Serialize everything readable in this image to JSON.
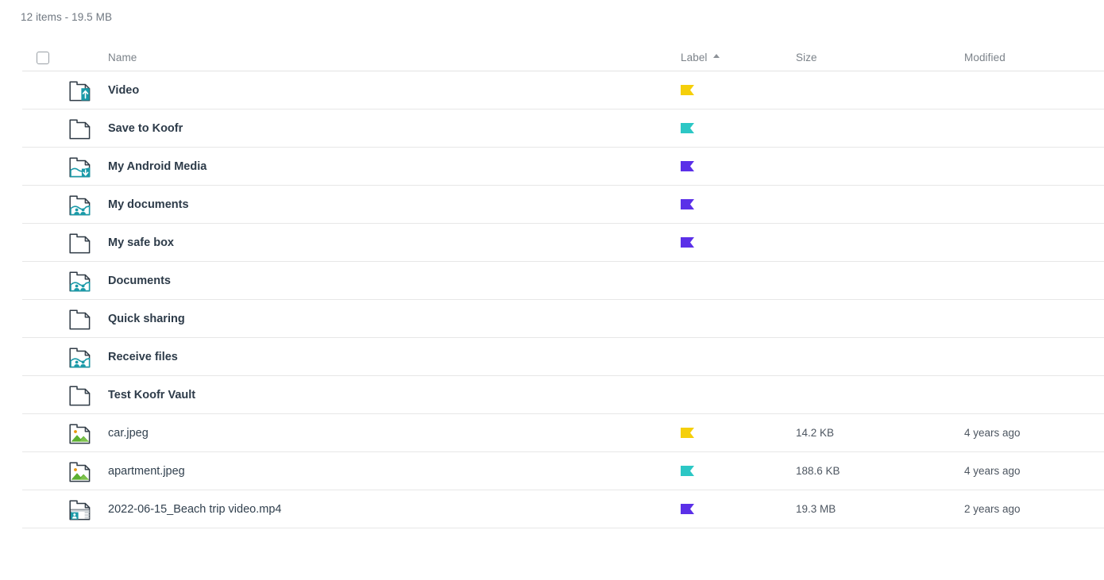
{
  "summary": "12 items - 19.5 MB",
  "columns": {
    "checkbox_name": "select-all",
    "name": "Name",
    "label": "Label",
    "size": "Size",
    "modified": "Modified",
    "sorted_by": "Label",
    "sort_direction": "ascending"
  },
  "label_colors": {
    "yellow": "#f5cf0a",
    "teal": "#2cc7c5",
    "purple": "#5b30e8"
  },
  "rows": [
    {
      "name": "Video",
      "icon": "document-upload-icon",
      "kind": "folder",
      "label_color": "#f5cf0a",
      "size": "",
      "modified": ""
    },
    {
      "name": "Save to Koofr",
      "icon": "document-icon",
      "kind": "folder",
      "label_color": "#2cc7c5",
      "size": "",
      "modified": ""
    },
    {
      "name": "My Android Media",
      "icon": "document-download-icon",
      "kind": "folder",
      "label_color": "#5b30e8",
      "size": "",
      "modified": ""
    },
    {
      "name": "My documents",
      "icon": "document-shared-icon",
      "kind": "folder",
      "label_color": "#5b30e8",
      "size": "",
      "modified": ""
    },
    {
      "name": "My safe box",
      "icon": "document-icon",
      "kind": "folder",
      "label_color": "#5b30e8",
      "size": "",
      "modified": ""
    },
    {
      "name": "Documents",
      "icon": "document-shared-icon",
      "kind": "folder",
      "label_color": "",
      "size": "",
      "modified": ""
    },
    {
      "name": "Quick sharing",
      "icon": "document-icon",
      "kind": "folder",
      "label_color": "",
      "size": "",
      "modified": ""
    },
    {
      "name": "Receive files",
      "icon": "document-shared-icon",
      "kind": "folder",
      "label_color": "",
      "size": "",
      "modified": ""
    },
    {
      "name": "Test Koofr Vault",
      "icon": "document-icon",
      "kind": "folder",
      "label_color": "",
      "size": "",
      "modified": ""
    },
    {
      "name": "car.jpeg",
      "icon": "image-file-icon",
      "kind": "file",
      "label_color": "#f5cf0a",
      "size": "14.2 KB",
      "modified": "4 years ago"
    },
    {
      "name": "apartment.jpeg",
      "icon": "image-file-icon",
      "kind": "file",
      "label_color": "#2cc7c5",
      "size": "188.6 KB",
      "modified": "4 years ago"
    },
    {
      "name": "2022-06-15_Beach trip video.mp4",
      "icon": "video-file-icon",
      "kind": "file",
      "label_color": "#5b30e8",
      "size": "19.3 MB",
      "modified": "2 years ago"
    }
  ]
}
